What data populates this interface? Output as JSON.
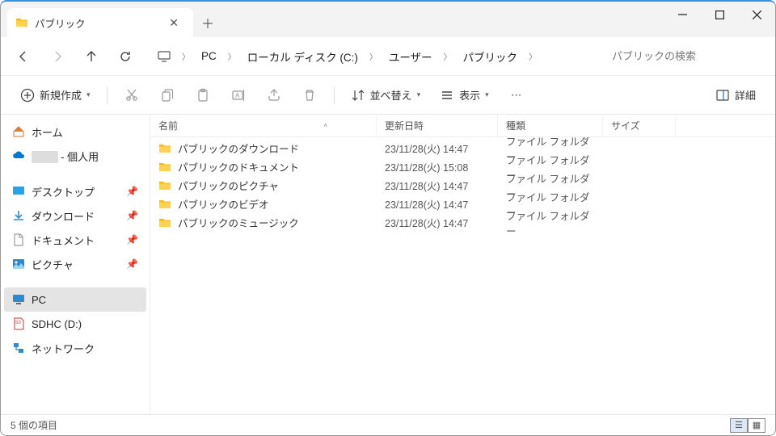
{
  "tab": {
    "title": "パブリック"
  },
  "breadcrumbs": [
    "PC",
    "ローカル ディスク (C:)",
    "ユーザー",
    "パブリック"
  ],
  "search": {
    "placeholder": "パブリックの検索"
  },
  "toolbar": {
    "new_label": "新規作成",
    "sort_label": "並べ替え",
    "view_label": "表示",
    "details_label": "詳細"
  },
  "sidebar": {
    "home": "ホーム",
    "personal_suffix": " - 個人用",
    "desktop": "デスクトップ",
    "downloads": "ダウンロード",
    "documents": "ドキュメント",
    "pictures": "ピクチャ",
    "pc": "PC",
    "sdhc": "SDHC (D:)",
    "network": "ネットワーク"
  },
  "columns": {
    "name": "名前",
    "date": "更新日時",
    "type": "種類",
    "size": "サイズ"
  },
  "rows": [
    {
      "name": "パブリックのダウンロード",
      "date": "23/11/28(火) 14:47",
      "type": "ファイル フォルダー"
    },
    {
      "name": "パブリックのドキュメント",
      "date": "23/11/28(火) 15:08",
      "type": "ファイル フォルダー"
    },
    {
      "name": "パブリックのピクチャ",
      "date": "23/11/28(火) 14:47",
      "type": "ファイル フォルダー"
    },
    {
      "name": "パブリックのビデオ",
      "date": "23/11/28(火) 14:47",
      "type": "ファイル フォルダー"
    },
    {
      "name": "パブリックのミュージック",
      "date": "23/11/28(火) 14:47",
      "type": "ファイル フォルダー"
    }
  ],
  "status": {
    "text": "5 個の項目"
  }
}
